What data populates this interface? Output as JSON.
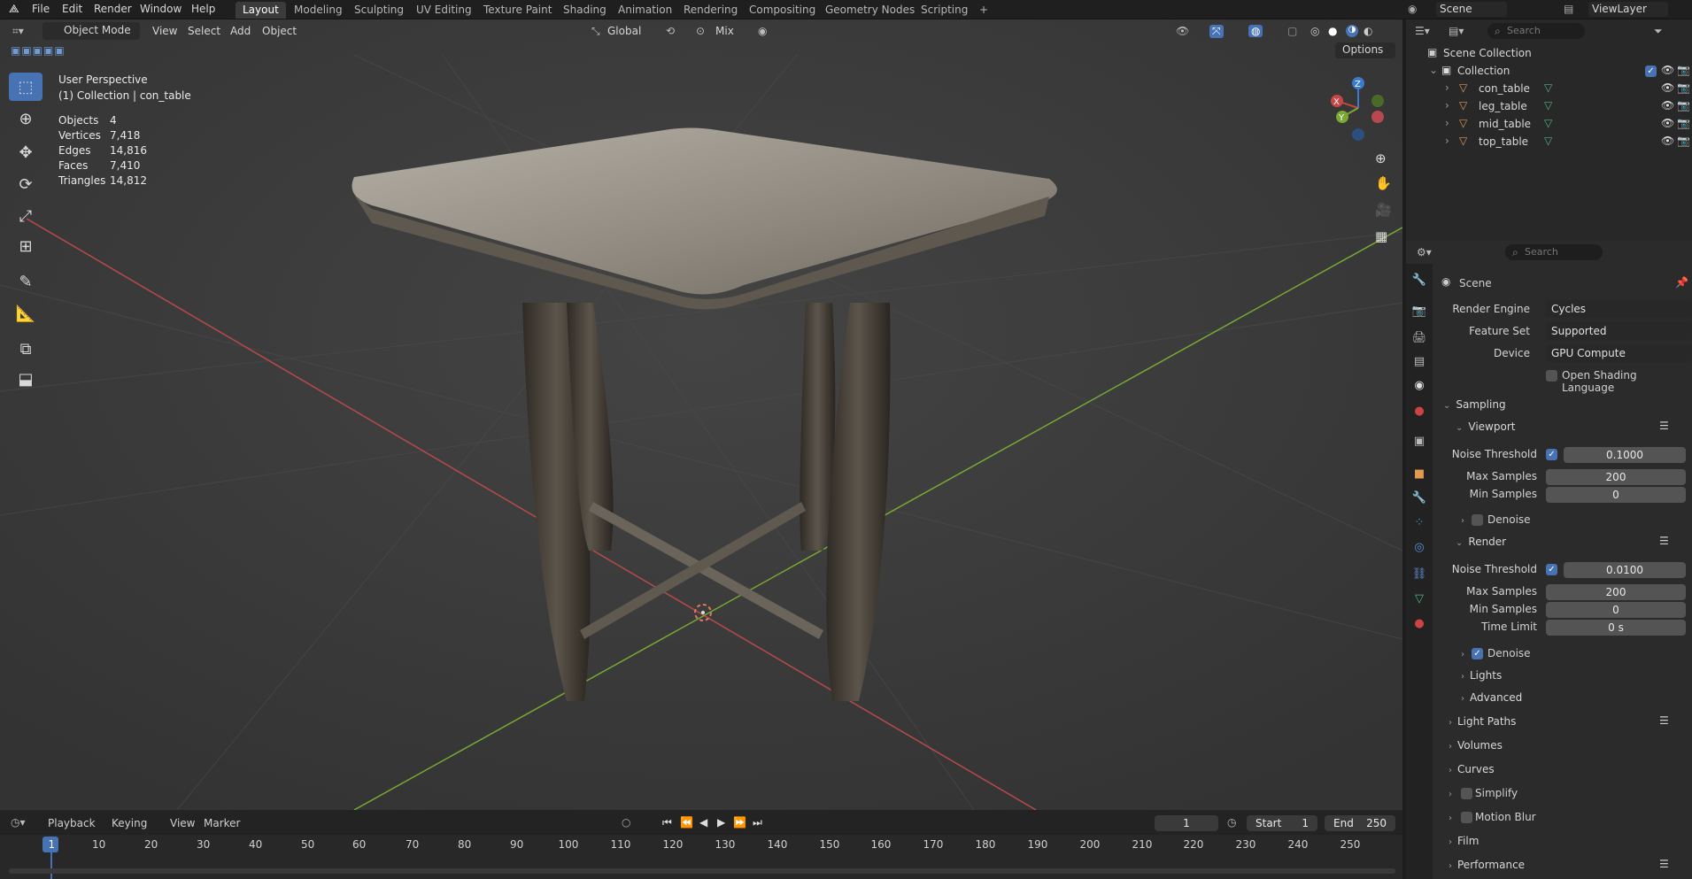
{
  "topbar": {
    "menus": [
      "File",
      "Edit",
      "Render",
      "Window",
      "Help"
    ],
    "workspaces": [
      "Layout",
      "Modeling",
      "Sculpting",
      "UV Editing",
      "Texture Paint",
      "Shading",
      "Animation",
      "Rendering",
      "Compositing",
      "Geometry Nodes",
      "Scripting"
    ],
    "add_tab": "+",
    "scene": "Scene",
    "view_layer": "ViewLayer"
  },
  "viewport_header": {
    "mode": "Object Mode",
    "menus": [
      "View",
      "Select",
      "Add",
      "Object"
    ],
    "transform_orientation": "Global",
    "snap": "Mix",
    "options": "Options"
  },
  "overlay": {
    "view_name": "User Perspective",
    "collection_line": "(1) Collection | con_table",
    "stats": [
      {
        "label": "Objects",
        "value": "4"
      },
      {
        "label": "Vertices",
        "value": "7,418"
      },
      {
        "label": "Edges",
        "value": "14,816"
      },
      {
        "label": "Faces",
        "value": "7,410"
      },
      {
        "label": "Triangles",
        "value": "14,812"
      }
    ]
  },
  "gizmo": {
    "x": "X",
    "y": "Y",
    "z": "Z"
  },
  "outliner": {
    "search_placeholder": "Search",
    "root": "Scene Collection",
    "collection": "Collection",
    "items": [
      "con_table",
      "leg_table",
      "mid_table",
      "top_table"
    ]
  },
  "properties": {
    "search_placeholder": "Search",
    "context": "Scene",
    "render_engine_label": "Render Engine",
    "render_engine": "Cycles",
    "feature_set_label": "Feature Set",
    "feature_set": "Supported",
    "device_label": "Device",
    "device": "GPU Compute",
    "osl_label": "Open Shading Language",
    "sampling": "Sampling",
    "viewport": "Viewport",
    "vp_noise_label": "Noise Threshold",
    "vp_noise": "0.1000",
    "vp_max_label": "Max Samples",
    "vp_max": "200",
    "vp_min_label": "Min Samples",
    "vp_min": "0",
    "vp_denoise": "Denoise",
    "render": "Render",
    "r_noise_label": "Noise Threshold",
    "r_noise": "0.0100",
    "r_max_label": "Max Samples",
    "r_max": "200",
    "r_min_label": "Min Samples",
    "r_min": "0",
    "r_time_label": "Time Limit",
    "r_time": "0 s",
    "r_denoise": "Denoise",
    "lights": "Lights",
    "advanced": "Advanced",
    "light_paths": "Light Paths",
    "volumes": "Volumes",
    "curves": "Curves",
    "simplify": "Simplify",
    "motion_blur": "Motion Blur",
    "film": "Film",
    "performance": "Performance"
  },
  "timeline": {
    "menus": [
      "Playback",
      "Keying",
      "View",
      "Marker"
    ],
    "current_frame": "1",
    "start_label": "Start",
    "start": "1",
    "end_label": "End",
    "end": "250",
    "ticks": [
      "1",
      "10",
      "20",
      "30",
      "40",
      "50",
      "60",
      "70",
      "80",
      "90",
      "100",
      "110",
      "120",
      "130",
      "140",
      "150",
      "160",
      "170",
      "180",
      "190",
      "200",
      "210",
      "220",
      "230",
      "240",
      "250"
    ]
  },
  "colors": {
    "accent": "#4772b3",
    "x_axis": "#c84646",
    "y_axis": "#7aa832",
    "z_axis": "#3a7ad0"
  }
}
